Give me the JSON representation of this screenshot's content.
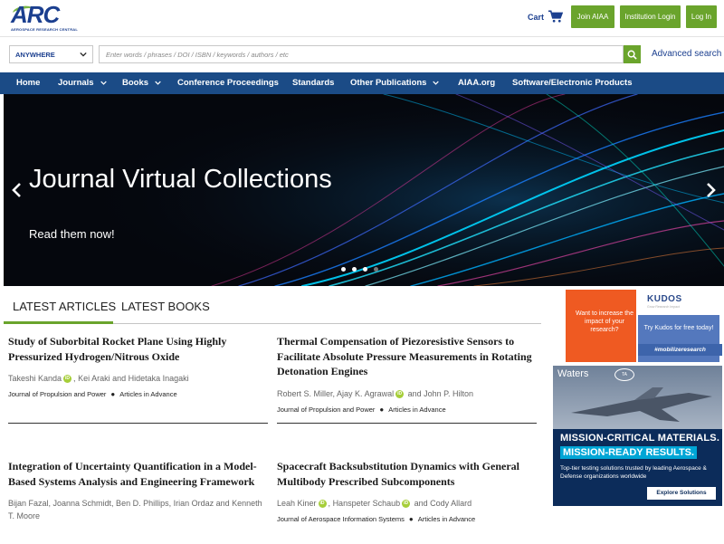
{
  "header": {
    "logo_text": "ARC",
    "logo_subtitle": "AEROSPACE RESEARCH CENTRAL",
    "cart_label": "Cart",
    "join_label": "Join AIAA",
    "institution_login_label": "Institution Login",
    "login_label": "Log In"
  },
  "search": {
    "scope_value": "ANYWHERE",
    "placeholder": "Enter words / phrases / DOI / ISBN / keywords / authors / etc",
    "advanced_label": "Advanced search"
  },
  "nav": {
    "items": [
      {
        "label": "Home",
        "has_dropdown": false
      },
      {
        "label": "Journals",
        "has_dropdown": true
      },
      {
        "label": "Books",
        "has_dropdown": true
      },
      {
        "label": "Conference Proceedings",
        "has_dropdown": false
      },
      {
        "label": "Standards",
        "has_dropdown": false
      },
      {
        "label": "Other Publications",
        "has_dropdown": true
      },
      {
        "label": "AIAA.org",
        "has_dropdown": false
      },
      {
        "label": "Software/Electronic Products",
        "has_dropdown": false
      }
    ]
  },
  "hero": {
    "title": "Journal Virtual Collections",
    "subtitle": "Read them now!",
    "slide_count": 4,
    "active_slide": 2
  },
  "tabs": {
    "items": [
      {
        "label": "LATEST ARTICLES",
        "active": true
      },
      {
        "label": "LATEST BOOKS",
        "active": false
      }
    ]
  },
  "articles": [
    {
      "title": "Study of Suborbital Rocket Plane Using Highly Pressurized Hydrogen/Nitrous Oxide",
      "authors": [
        {
          "name": "Takeshi Kanda",
          "orcid": true
        },
        {
          "name": "Kei Araki",
          "orcid": false
        },
        {
          "name": "Hidetaka Inagaki",
          "orcid": false
        }
      ],
      "journal": "Journal of Propulsion and Power",
      "status": "Articles in Advance"
    },
    {
      "title": "Thermal Compensation of Piezoresistive Sensors to Facilitate Absolute Pressure Measurements in Rotating Detonation Engines",
      "authors": [
        {
          "name": "Robert S. Miller",
          "orcid": false
        },
        {
          "name": "Ajay K. Agrawal",
          "orcid": true
        },
        {
          "name": "John P. Hilton",
          "orcid": false
        }
      ],
      "journal": "Journal of Propulsion and Power",
      "status": "Articles in Advance"
    },
    {
      "title": "Integration of Uncertainty Quantification in a Model-Based Systems Analysis and Engineering Framework",
      "authors_text": "Bijan Fazal,  Joanna Schmidt,  Ben D. Phillips,  Irian Ordaz and Kenneth T. Moore"
    },
    {
      "title": "Spacecraft Backsubstitution Dynamics with General Multibody Prescribed Subcomponents",
      "authors": [
        {
          "name": "Leah Kiner",
          "orcid": true
        },
        {
          "name": "Hanspeter Schaub",
          "orcid": true
        },
        {
          "name": "Cody Allard",
          "orcid": false
        }
      ],
      "journal": "Journal of Aerospace Information Systems",
      "status": "Articles in Advance"
    }
  ],
  "ads": {
    "kudos": {
      "logo": "KUDOS",
      "logo_sub": "Grow Research Impact",
      "left_text": "Want to increase the impact of your research?",
      "right_text": "Try Kudos for free today!",
      "hashtag": "#mobilizeresearch"
    },
    "waters": {
      "logo": "Waters",
      "ta_logo": "TA",
      "headline1": "MISSION-CRITICAL MATERIALS.",
      "headline2": "MISSION-READY RESULTS.",
      "body": "Top-tier testing solutions trusted by leading Aerospace & Defense organizations worldwide",
      "cta": "Explore Solutions"
    }
  },
  "colors": {
    "brand_blue": "#1b4b86",
    "brand_green": "#6aa42c",
    "orcid_green": "#a6ce39"
  }
}
